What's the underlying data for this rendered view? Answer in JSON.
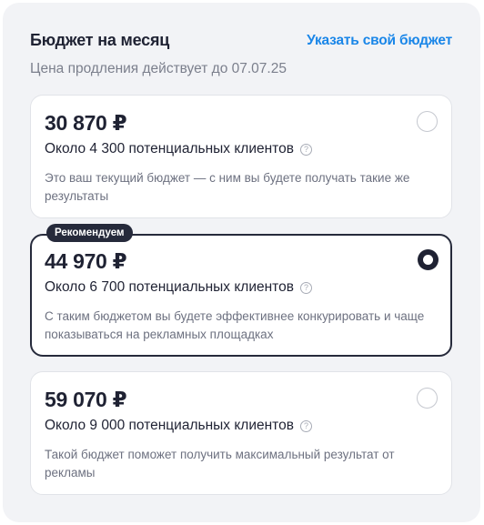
{
  "header": {
    "title": "Бюджет на месяц",
    "custom_budget_link": "Указать свой бюджет",
    "subtitle": "Цена продления действует до 07.07.25"
  },
  "options": [
    {
      "price": "30 870 ₽",
      "clients": "Около 4 300 потенциальных клиентов",
      "description": "Это ваш текущий бюджет — с ним вы будете получать такие же результаты",
      "selected": false
    },
    {
      "badge": "Рекомендуем",
      "price": "44 970 ₽",
      "clients": "Около 6 700 потенциальных клиентов",
      "description": "С таким бюджетом вы будете эффективнее конкурировать и чаще показываться на рекламных площадках",
      "selected": true
    },
    {
      "price": "59 070 ₽",
      "clients": "Около 9 000 потенциальных клиентов",
      "description": "Такой бюджет поможет получить максимальный результат от рекламы",
      "selected": false
    }
  ],
  "icons": {
    "help": "?"
  },
  "colors": {
    "link": "#1a86e8",
    "selected_border": "#262a3b",
    "panel_background": "#f2f3f6"
  }
}
